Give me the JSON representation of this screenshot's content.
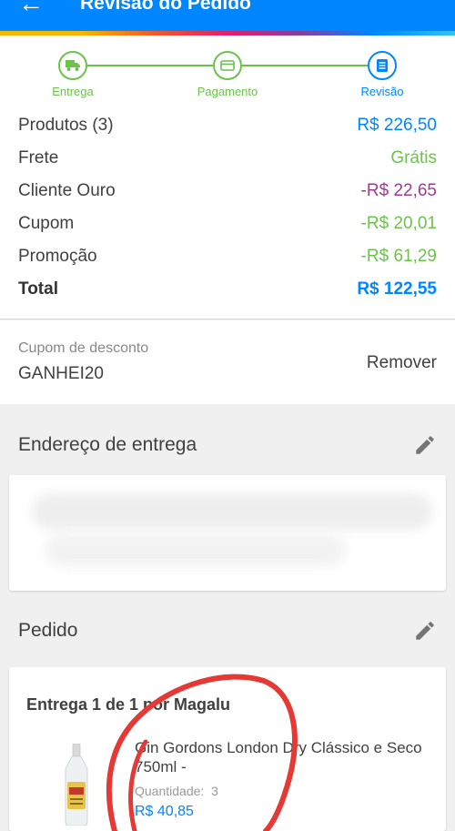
{
  "appbar": {
    "back_icon": "arrow-left-icon",
    "title": "Revisão do Pedido"
  },
  "colors": {
    "primary": "#0086ff",
    "success": "#6cc24a",
    "purple": "#9b3d8c",
    "annotation": "#e53935"
  },
  "stepper": {
    "steps": [
      {
        "label": "Entrega",
        "icon": "truck-icon",
        "state": "done"
      },
      {
        "label": "Pagamento",
        "icon": "card-icon",
        "state": "done"
      },
      {
        "label": "Revisão",
        "icon": "document-icon",
        "state": "current"
      }
    ]
  },
  "summary": {
    "rows": [
      {
        "label": "Produtos (3)",
        "value": "R$ 226,50"
      },
      {
        "label": "Frete",
        "value": "Grátis"
      },
      {
        "label": "Cliente Ouro",
        "value": "-R$ 22,65"
      },
      {
        "label": "Cupom",
        "value": "-R$ 20,01"
      },
      {
        "label": "Promoção",
        "value": "-R$ 61,29"
      }
    ],
    "total": {
      "label": "Total",
      "value": "R$ 122,55"
    }
  },
  "coupon": {
    "label": "Cupom de desconto",
    "code": "GANHEI20",
    "remove_label": "Remover"
  },
  "address": {
    "title": "Endereço de entrega",
    "edit_icon": "pencil-icon"
  },
  "order": {
    "title": "Pedido",
    "edit_icon": "pencil-icon",
    "shipment_title": "Entrega 1 de 1 por Magalu",
    "product": {
      "name": "Gin Gordons London Dry Clássico e Seco 750ml -",
      "quantity_label": "Quantidade:",
      "quantity": "3",
      "price": "R$ 40,85"
    }
  }
}
